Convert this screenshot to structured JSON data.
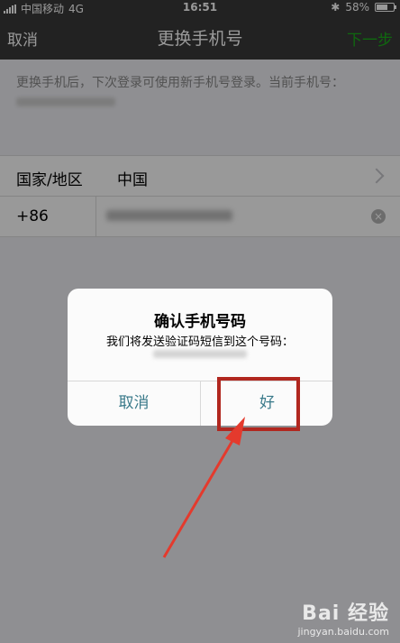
{
  "status_bar": {
    "carrier": "中国移动",
    "network": "4G",
    "time": "16:51",
    "battery": "58%",
    "battery_level": 0.58
  },
  "nav": {
    "cancel": "取消",
    "title": "更换手机号",
    "next": "下一步",
    "next_color": "#1aad19"
  },
  "info": {
    "text": "更换手机后，下次登录可使用新手机号登录。当前手机号："
  },
  "form": {
    "country_label": "国家/地区",
    "country_value": "中国",
    "country_code": "+86"
  },
  "dialog": {
    "title": "确认手机号码",
    "message": "我们将发送验证码短信到这个号码：",
    "cancel": "取消",
    "ok": "好",
    "button_color": "#3a7a8a"
  },
  "annotation": {
    "highlight_color": "#b1271f"
  },
  "watermark": {
    "brand": "Bai 经验",
    "url": "jingyan.baidu.com"
  }
}
